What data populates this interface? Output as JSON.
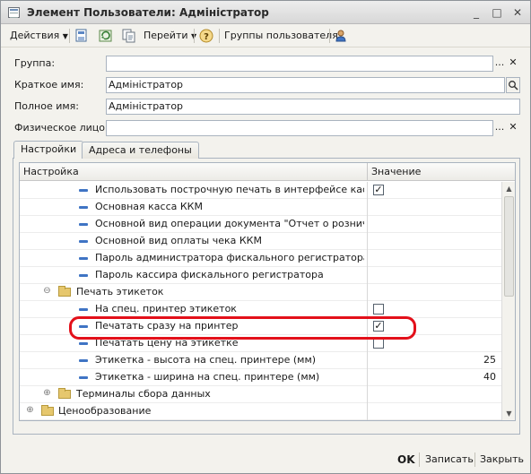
{
  "window": {
    "title": "Элемент Пользователи: Адміністратор"
  },
  "titlebar_buttons": {
    "minimize": "_",
    "maximize": "□",
    "close": "✕"
  },
  "toolbar": {
    "actions_label": "Действия",
    "go_label": "Перейти",
    "help_label": "?",
    "groups_label": "Группы пользователя"
  },
  "form": {
    "group": {
      "label": "Группа:",
      "value": ""
    },
    "short_name": {
      "label": "Краткое имя:",
      "value": "Адміністратор"
    },
    "full_name": {
      "label": "Полное имя:",
      "value": "Адміністратор"
    },
    "person": {
      "label": "Физическое лицо:",
      "value": ""
    },
    "ellipsis": "...",
    "clear": "✕",
    "search": "⌕"
  },
  "tabs": [
    {
      "label": "Настройки",
      "active": true
    },
    {
      "label": "Адреса и телефоны",
      "active": false
    }
  ],
  "tree": {
    "col_setting": "Настройка",
    "col_value": "Значение",
    "rows": [
      {
        "name": "Использовать построчную печать в интерфейсе кассира",
        "kind": "item",
        "checkbox": true,
        "checked": true,
        "number": ""
      },
      {
        "name": "Основная касса ККМ",
        "kind": "item",
        "checkbox": false,
        "checked": false,
        "number": ""
      },
      {
        "name": "Основной вид операции документа \"Отчет о розничных п...",
        "kind": "item",
        "checkbox": false,
        "checked": false,
        "number": ""
      },
      {
        "name": "Основной вид оплаты чека ККМ",
        "kind": "item",
        "checkbox": false,
        "checked": false,
        "number": ""
      },
      {
        "name": "Пароль администратора фискального регистратора",
        "kind": "item",
        "checkbox": false,
        "checked": false,
        "number": ""
      },
      {
        "name": "Пароль кассира фискального регистратора",
        "kind": "item",
        "checkbox": false,
        "checked": false,
        "number": ""
      },
      {
        "name": "Печать этикеток",
        "kind": "folder-open",
        "checkbox": false,
        "checked": false,
        "number": ""
      },
      {
        "name": "На спец. принтер этикеток",
        "kind": "item",
        "checkbox": true,
        "checked": false,
        "number": ""
      },
      {
        "name": "Печатать сразу на принтер",
        "kind": "item",
        "checkbox": true,
        "checked": true,
        "number": ""
      },
      {
        "name": "Печатать цену на этикетке",
        "kind": "item",
        "checkbox": true,
        "checked": false,
        "number": ""
      },
      {
        "name": "Этикетка - высота на спец. принтере (мм)",
        "kind": "item",
        "checkbox": false,
        "checked": false,
        "number": "25"
      },
      {
        "name": "Этикетка - ширина на спец. принтере (мм)",
        "kind": "item",
        "checkbox": false,
        "checked": false,
        "number": "40"
      },
      {
        "name": "Терминалы сбора данных",
        "kind": "folder-closed",
        "checkbox": false,
        "checked": false,
        "number": ""
      },
      {
        "name": "Ценообразование",
        "kind": "folder-closed-root",
        "checkbox": false,
        "checked": false,
        "number": ""
      }
    ]
  },
  "bottom": {
    "ok_label": "OK",
    "save_label": "Записать",
    "close_label": "Закрыть"
  }
}
